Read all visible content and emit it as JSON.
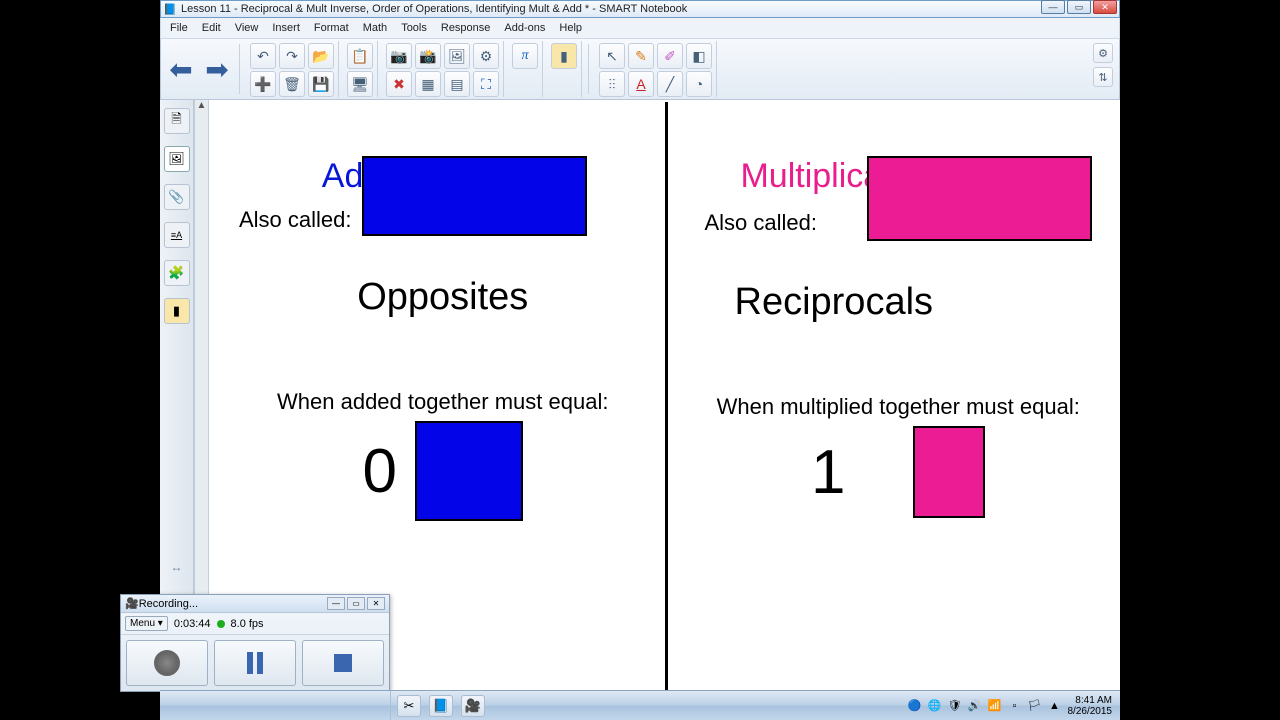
{
  "window": {
    "title": "Lesson 11 - Reciprocal & Mult Inverse, Order of Operations, Identifying Mult & Add * - SMART Notebook"
  },
  "menu": {
    "items": [
      "File",
      "Edit",
      "View",
      "Insert",
      "Format",
      "Math",
      "Tools",
      "Response",
      "Add-ons",
      "Help"
    ]
  },
  "content": {
    "left": {
      "title": "Additive Inverse",
      "also_called": "Also called:",
      "word": "Opposites",
      "rule": "When added together must equal:",
      "result": "0"
    },
    "right": {
      "title": "Multiplicative Inverse",
      "also_called": "Also called:",
      "word": "Reciprocals",
      "rule": "When multiplied together must equal:",
      "result": "1"
    }
  },
  "recorder": {
    "title": "Recording...",
    "menu": "Menu",
    "time": "0:03:44",
    "fps": "8.0 fps"
  },
  "clock": {
    "time": "8:41 AM",
    "date": "8/26/2015"
  }
}
